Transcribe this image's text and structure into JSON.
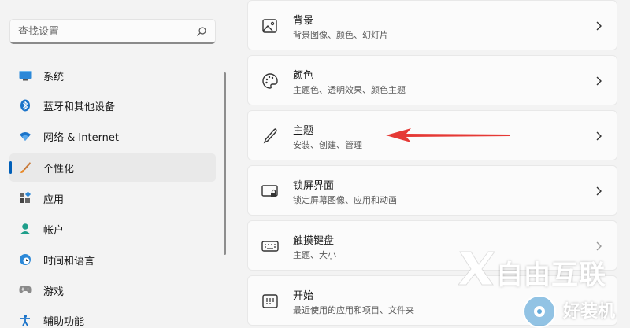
{
  "search": {
    "placeholder": "查找设置"
  },
  "sidebar": {
    "items": [
      {
        "label": "系统",
        "icon": "monitor-icon"
      },
      {
        "label": "蓝牙和其他设备",
        "icon": "bluetooth-icon"
      },
      {
        "label": "网络 & Internet",
        "icon": "wifi-icon"
      },
      {
        "label": "个性化",
        "icon": "brush-icon",
        "active": true
      },
      {
        "label": "应用",
        "icon": "apps-icon"
      },
      {
        "label": "帐户",
        "icon": "account-icon"
      },
      {
        "label": "时间和语言",
        "icon": "globe-clock-icon"
      },
      {
        "label": "游戏",
        "icon": "gamepad-icon"
      },
      {
        "label": "辅助功能",
        "icon": "accessibility-icon"
      }
    ]
  },
  "cards": [
    {
      "title": "背景",
      "subtitle": "背景图像、颜色、幻灯片",
      "icon": "picture-icon"
    },
    {
      "title": "颜色",
      "subtitle": "主题色、透明效果、颜色主题",
      "icon": "palette-icon"
    },
    {
      "title": "主题",
      "subtitle": "安装、创建、管理",
      "icon": "pen-icon"
    },
    {
      "title": "锁屏界面",
      "subtitle": "锁定屏幕图像、应用和动画",
      "icon": "lock-screen-icon"
    },
    {
      "title": "触摸键盘",
      "subtitle": "主题、大小",
      "icon": "keyboard-icon"
    },
    {
      "title": "开始",
      "subtitle": "最近使用的应用和项目、文件夹",
      "icon": "start-menu-icon"
    }
  ],
  "watermark": {
    "line1": "自由互联",
    "line2": "好装机"
  },
  "colors": {
    "accent": "#005fb8",
    "annotation_arrow": "#e53935"
  }
}
